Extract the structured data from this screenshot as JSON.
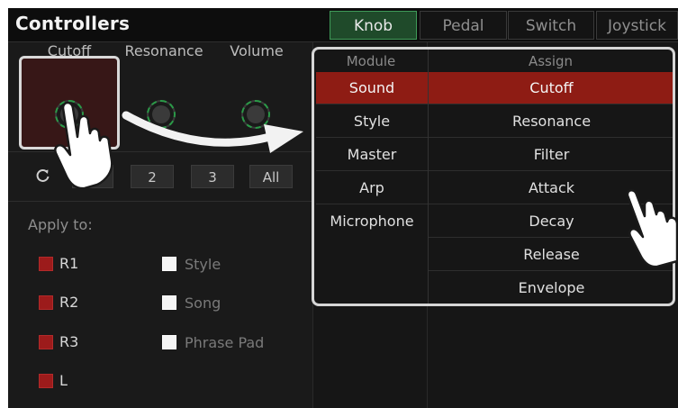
{
  "app": {
    "title": "Controllers"
  },
  "tabs": [
    {
      "label": "Knob",
      "active": true
    },
    {
      "label": "Pedal",
      "active": false
    },
    {
      "label": "Switch",
      "active": false
    },
    {
      "label": "Joystick",
      "active": false
    }
  ],
  "knobs": [
    {
      "label": "Cutoff",
      "selected": true
    },
    {
      "label": "Resonance",
      "selected": false
    },
    {
      "label": "Volume",
      "selected": false
    }
  ],
  "bank": {
    "reset_icon": "refresh-icon",
    "buttons": [
      "1",
      "2",
      "3",
      "All"
    ]
  },
  "apply": {
    "label": "Apply to:",
    "parts": [
      {
        "label": "R1",
        "checked": true
      },
      {
        "label": "R2",
        "checked": true
      },
      {
        "label": "R3",
        "checked": true
      },
      {
        "label": "L",
        "checked": true
      }
    ],
    "targets": [
      {
        "label": "Style",
        "checked": false
      },
      {
        "label": "Song",
        "checked": false
      },
      {
        "label": "Phrase Pad",
        "checked": false
      }
    ]
  },
  "assign_panel": {
    "module_header": "Module",
    "assign_header": "Assign",
    "modules": [
      "Sound",
      "Style",
      "Master",
      "Arp",
      "Microphone"
    ],
    "assigns": [
      "Cutoff",
      "Resonance",
      "Filter",
      "Attack",
      "Decay",
      "Release",
      "Envelope"
    ],
    "selected_module": "Sound",
    "selected_assign": "Cutoff"
  },
  "colors": {
    "accent_green": "#3f9a58",
    "selection_red": "#8e1c14",
    "checkbox_red": "#9c1b1b",
    "highlight_border": "#d6d6d6"
  }
}
